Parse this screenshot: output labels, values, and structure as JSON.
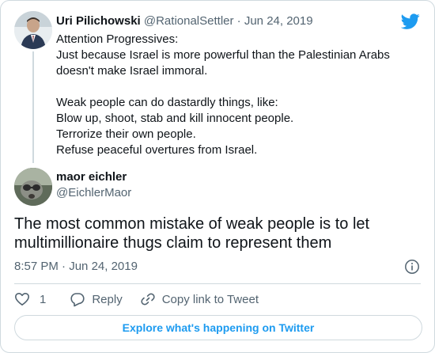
{
  "parent_tweet": {
    "name": "Uri Pilichowski",
    "handle": "@RationalSettler",
    "separator": "·",
    "date": "Jun 24, 2019",
    "lines": [
      "Attention Progressives:",
      "Just because Israel is more powerful than the Palestinian Arabs",
      "doesn't make Israel immoral.",
      "",
      "Weak people can do dastardly things, like:",
      "Blow up, shoot, stab and kill innocent people.",
      "Terrorize their own people.",
      "Refuse peaceful overtures from Israel."
    ]
  },
  "tweet": {
    "name": "maor eichler",
    "handle": "@EichlerMaor",
    "text": "The most common mistake of weak people is to let multimillionaire thugs claim to represent them",
    "time": "8:57 PM",
    "separator": "·",
    "date": "Jun 24, 2019"
  },
  "actions": {
    "like_count": "1",
    "reply_label": "Reply",
    "copy_link_label": "Copy link to Tweet"
  },
  "explore_label": "Explore what's happening on Twitter",
  "colors": {
    "brand_blue": "#1d9bf0",
    "muted_text": "#536471",
    "border": "#cfd9de"
  },
  "icons": [
    "twitter-bird-icon",
    "info-icon",
    "heart-icon",
    "reply-icon",
    "link-icon"
  ]
}
